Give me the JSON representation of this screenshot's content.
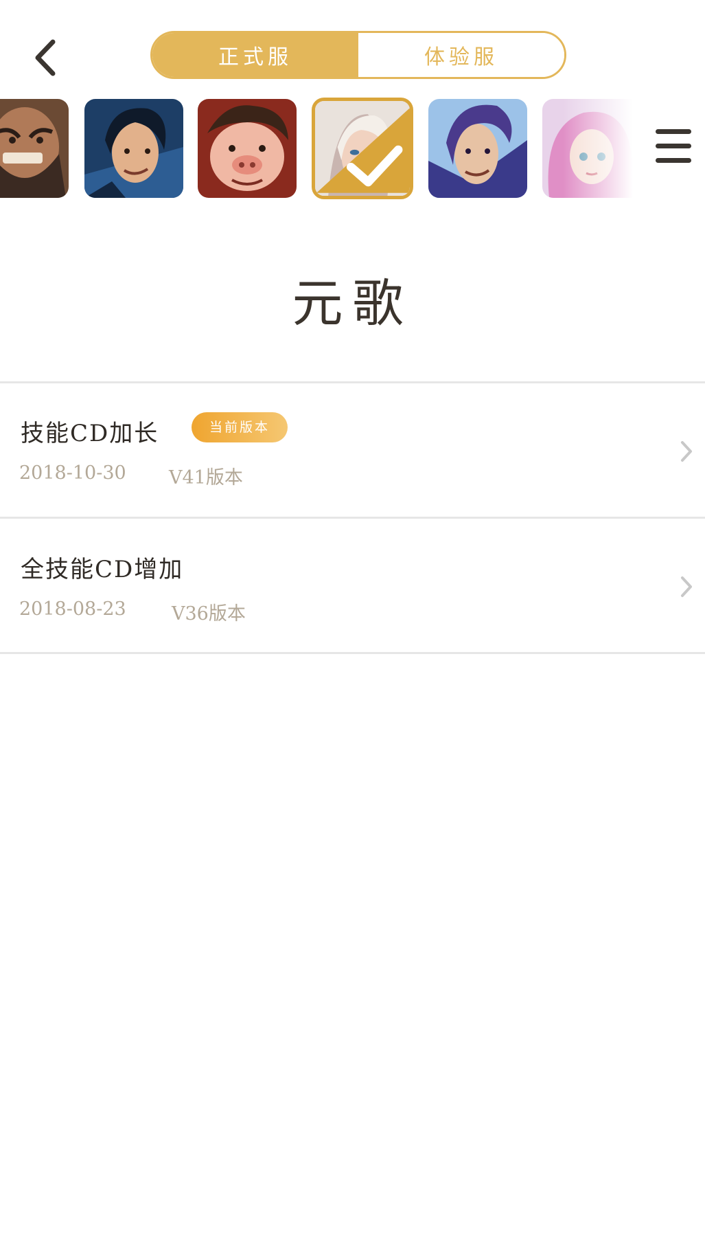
{
  "header": {
    "tabs": [
      {
        "label": "正式服",
        "active": true
      },
      {
        "label": "体验服",
        "active": false
      }
    ]
  },
  "heroes": [
    {
      "name": "hero-portrait-1",
      "selected": false
    },
    {
      "name": "hero-portrait-2",
      "selected": false
    },
    {
      "name": "hero-portrait-3",
      "selected": false
    },
    {
      "name": "hero-portrait-4",
      "selected": true
    },
    {
      "name": "hero-portrait-5",
      "selected": false
    },
    {
      "name": "hero-portrait-6",
      "selected": false
    }
  ],
  "hero_name": "元歌",
  "changes": [
    {
      "title": "技能CD加长",
      "badge": "当前版本",
      "date": "2018-10-30",
      "version": "V41版本"
    },
    {
      "title": "全技能CD增加",
      "badge": "",
      "date": "2018-08-23",
      "version": "V36版本"
    }
  ],
  "colors": {
    "accent": "#e3b75a",
    "badge_start": "#efa530",
    "badge_end": "#f5c772",
    "title_text": "#3b342d",
    "meta_text": "#b3a897"
  }
}
